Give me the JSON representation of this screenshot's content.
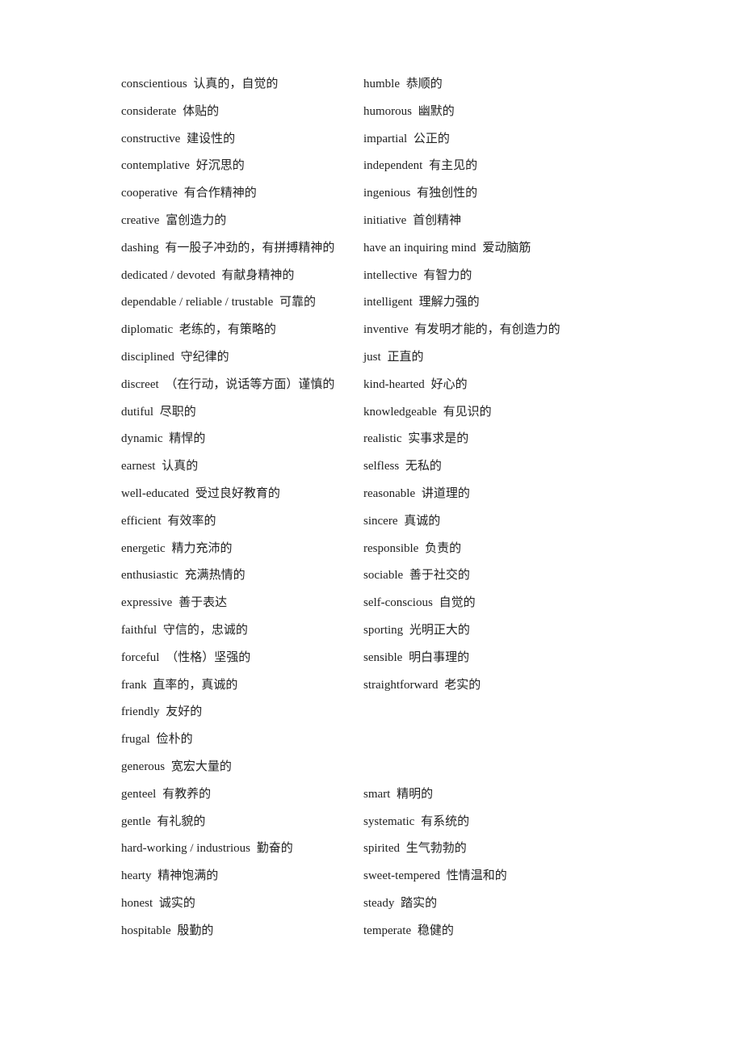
{
  "left_column": [
    {
      "en": "conscientious",
      "zh": "认真的，自觉的"
    },
    {
      "en": "considerate",
      "zh": "体贴的"
    },
    {
      "en": "constructive",
      "zh": "建设性的"
    },
    {
      "en": "contemplative",
      "zh": "好沉思的"
    },
    {
      "en": "cooperative",
      "zh": "有合作精神的"
    },
    {
      "en": "creative",
      "zh": "富创造力的"
    },
    {
      "en": "dashing",
      "zh": "有一股子冲劲的，有拼搏精神的"
    },
    {
      "en": "dedicated / devoted",
      "zh": "有献身精神的"
    },
    {
      "en": "dependable / reliable / trustable",
      "zh": "可靠的"
    },
    {
      "en": "diplomatic",
      "zh": "老练的，有策略的"
    },
    {
      "en": "disciplined",
      "zh": "守纪律的"
    },
    {
      "en": "discreet",
      "zh": "（在行动，说话等方面）谨慎的"
    },
    {
      "en": "dutiful",
      "zh": "尽职的"
    },
    {
      "en": "dynamic",
      "zh": "精悍的"
    },
    {
      "en": "earnest",
      "zh": "认真的"
    },
    {
      "en": "well-educated",
      "zh": "受过良好教育的"
    },
    {
      "en": "efficient",
      "zh": "有效率的"
    },
    {
      "en": "energetic",
      "zh": "精力充沛的"
    },
    {
      "en": "enthusiastic",
      "zh": "充满热情的"
    },
    {
      "en": "expressive",
      "zh": "善于表达"
    },
    {
      "en": "faithful",
      "zh": "守信的，忠诚的"
    },
    {
      "en": "forceful",
      "zh": "（性格）坚强的"
    },
    {
      "en": "frank",
      "zh": "直率的，真诚的"
    },
    {
      "en": "friendly",
      "zh": "友好的"
    },
    {
      "en": "frugal",
      "zh": "俭朴的"
    },
    {
      "en": "generous",
      "zh": "宽宏大量的"
    },
    {
      "en": "genteel",
      "zh": "有教养的"
    },
    {
      "en": "gentle",
      "zh": "有礼貌的"
    },
    {
      "en": "hard-working / industrious",
      "zh": "勤奋的"
    },
    {
      "en": "hearty",
      "zh": "精神饱满的"
    },
    {
      "en": "honest",
      "zh": "诚实的"
    },
    {
      "en": "hospitable",
      "zh": "殷勤的"
    }
  ],
  "right_column": [
    {
      "en": "humble",
      "zh": "恭顺的"
    },
    {
      "en": "humorous",
      "zh": "幽默的"
    },
    {
      "en": "impartial",
      "zh": "公正的"
    },
    {
      "en": "independent",
      "zh": "有主见的"
    },
    {
      "en": "ingenious",
      "zh": "有独创性的"
    },
    {
      "en": "initiative",
      "zh": "首创精神"
    },
    {
      "en": "have an inquiring mind",
      "zh": "爱动脑筋"
    },
    {
      "en": "intellective",
      "zh": "有智力的"
    },
    {
      "en": "intelligent",
      "zh": "理解力强的"
    },
    {
      "en": "inventive",
      "zh": "有发明才能的，有创造力的"
    },
    {
      "en": "just",
      "zh": "正直的"
    },
    {
      "en": "kind-hearted",
      "zh": "好心的"
    },
    {
      "en": "knowledgeable",
      "zh": "有见识的"
    },
    {
      "en": "realistic",
      "zh": "实事求是的"
    },
    {
      "en": "selfless",
      "zh": "无私的"
    },
    {
      "en": "reasonable",
      "zh": "讲道理的"
    },
    {
      "en": "sincere",
      "zh": "真诚的"
    },
    {
      "en": "responsible",
      "zh": "负责的"
    },
    {
      "en": "sociable",
      "zh": "善于社交的"
    },
    {
      "en": "self-conscious",
      "zh": "自觉的"
    },
    {
      "en": "sporting",
      "zh": "光明正大的"
    },
    {
      "en": "sensible",
      "zh": "明白事理的"
    },
    {
      "en": "straightforward",
      "zh": "老实的"
    },
    {
      "blank": true
    },
    {
      "blank": true
    },
    {
      "blank": true
    },
    {
      "en": "smart",
      "zh": "精明的"
    },
    {
      "en": "systematic",
      "zh": "有系统的"
    },
    {
      "en": "spirited",
      "zh": "生气勃勃的"
    },
    {
      "en": "sweet-tempered",
      "zh": "性情温和的"
    },
    {
      "en": "steady",
      "zh": "踏实的"
    },
    {
      "en": "temperate",
      "zh": "稳健的"
    }
  ]
}
